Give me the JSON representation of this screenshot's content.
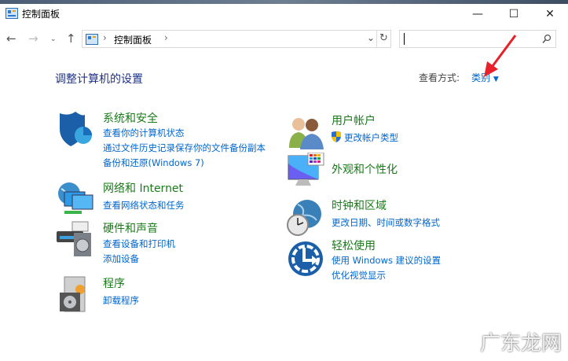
{
  "window": {
    "title": "控制面板"
  },
  "address": {
    "path": "控制面板",
    "search_placeholder": ""
  },
  "main": {
    "heading": "调整计算机的设置",
    "view_by_label": "查看方式:",
    "view_by_value": "类别"
  },
  "categories": [
    {
      "title": "系统和安全",
      "links": [
        "查看你的计算机状态",
        "通过文件历史记录保存你的文件备份副本",
        "备份和还原(Windows 7)"
      ]
    },
    {
      "title": "网络和 Internet",
      "links": [
        "查看网络状态和任务"
      ]
    },
    {
      "title": "硬件和声音",
      "links": [
        "查看设备和打印机",
        "添加设备"
      ]
    },
    {
      "title": "程序",
      "links": [
        "卸载程序"
      ]
    },
    {
      "title": "用户帐户",
      "links": [
        "更改帐户类型"
      ]
    },
    {
      "title": "外观和个性化",
      "links": []
    },
    {
      "title": "时钟和区域",
      "links": [
        "更改日期、时间或数字格式"
      ]
    },
    {
      "title": "轻松使用",
      "links": [
        "使用 Windows 建议的设置",
        "优化视觉显示"
      ]
    }
  ],
  "watermark": "广东龙网",
  "colors": {
    "link": "#0066cc",
    "category": "#1a7a1a",
    "heading": "#1e3287",
    "arrow": "#e8202a"
  }
}
